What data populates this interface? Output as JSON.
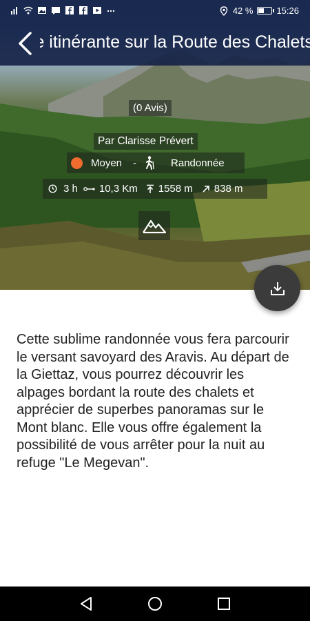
{
  "status_bar": {
    "battery_percent": "42 %",
    "time": "15:26",
    "battery_level": 0.42,
    "left_icons": [
      "sim-icon",
      "wifi-icon",
      "gallery-icon",
      "message-icon",
      "facebook-icon",
      "facebook-icon",
      "video-icon",
      "more-icon"
    ]
  },
  "header": {
    "title": "Journée itinérante sur la Route des Chalets"
  },
  "hike": {
    "reviews": "(0 Avis)",
    "author": "Par Clarisse Prévert",
    "difficulty": "Moyen",
    "difficulty_color": "#ef6b2e",
    "separator": "-",
    "activity": "Randonnée",
    "duration": "3 h",
    "distance": "10,3 Km",
    "max_altitude": "1558 m",
    "elevation_gain": "838 m"
  },
  "description": "Cette sublime randonnée vous fera parcourir le versant savoyard des Aravis. Au départ de la Giettaz, vous pourrez découvrir les alpages bordant la route des chalets et apprécier de superbes panoramas sur le Mont blanc. Elle vous offre également la possibilité de vous arrêter pour la nuit au refuge \"Le Megevan\".",
  "colors": {
    "header_bg": "#162346",
    "fab_bg": "#3b3b3b"
  }
}
